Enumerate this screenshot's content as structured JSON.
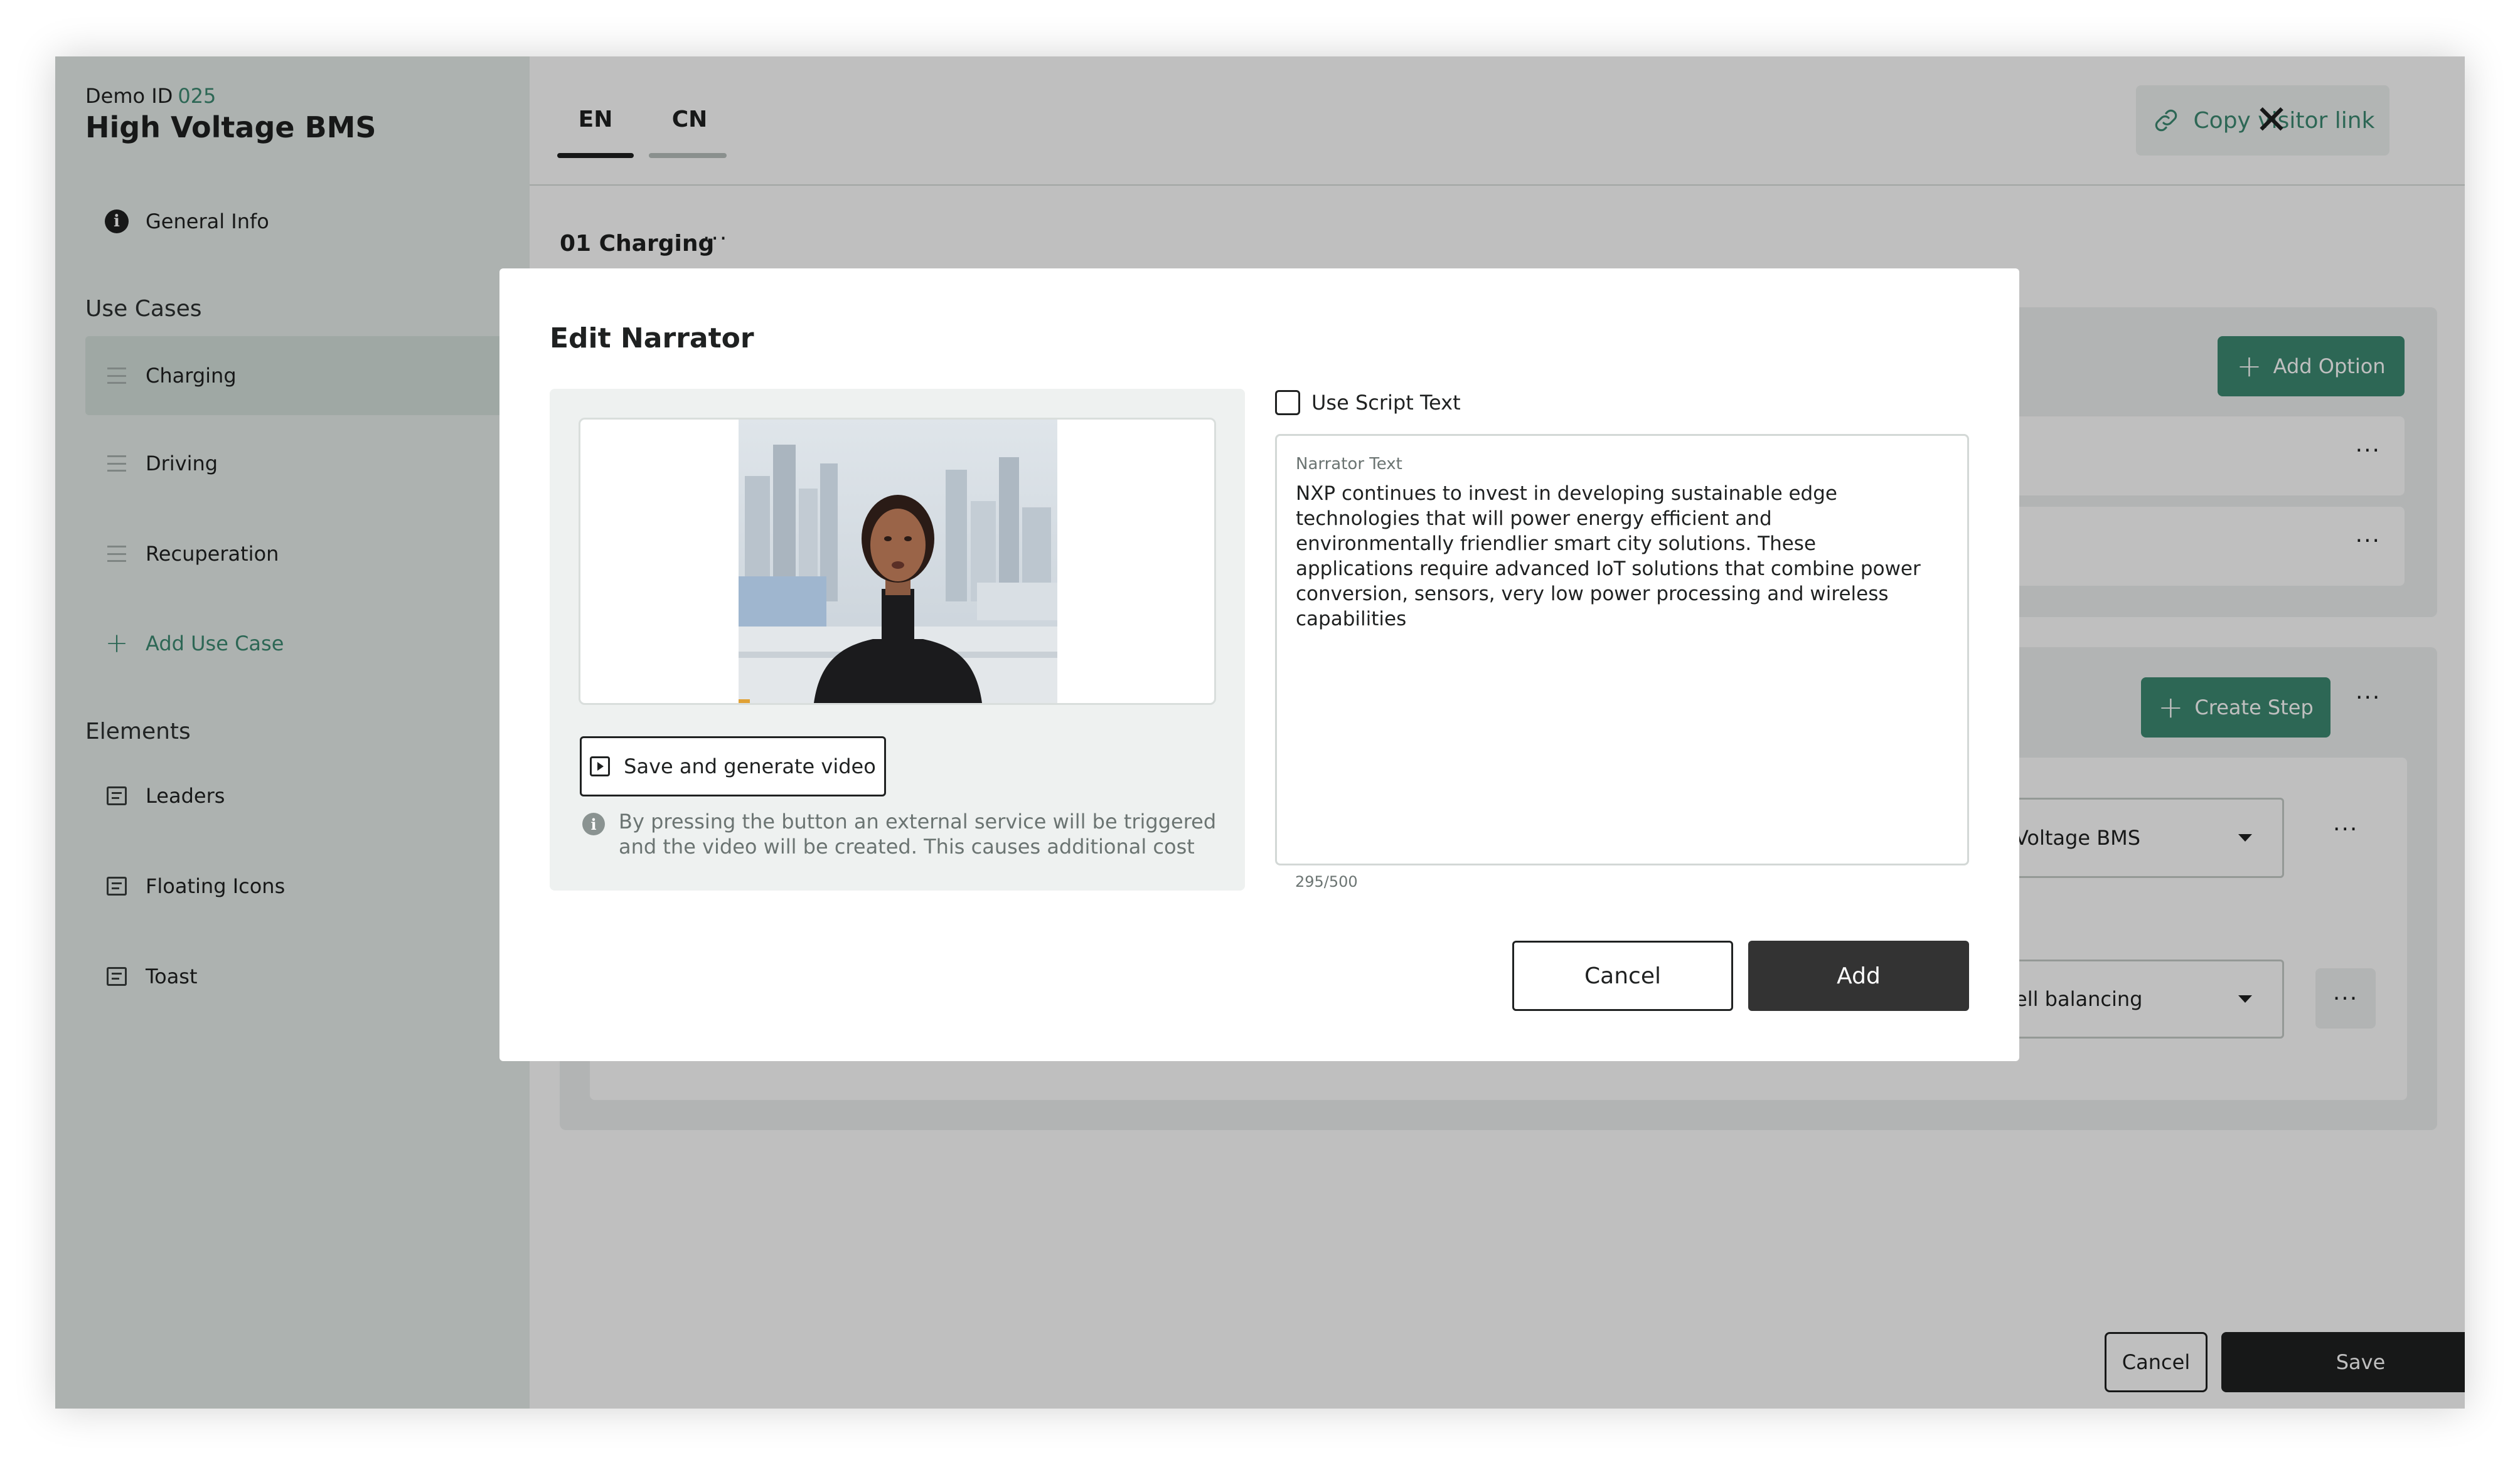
{
  "sidebar": {
    "demo_id_label": "Demo ID",
    "demo_id_value": "025",
    "title": "High Voltage BMS",
    "general_info": "General Info",
    "use_cases_heading": "Use Cases",
    "use_cases": [
      "Charging",
      "Driving",
      "Recuperation"
    ],
    "add_use_case": "Add Use Case",
    "elements_heading": "Elements",
    "elements": [
      "Leaders",
      "Floating Icons",
      "Toast"
    ]
  },
  "header": {
    "tabs": [
      "EN",
      "CN"
    ],
    "copy_link": "Copy visitor link"
  },
  "main": {
    "use_case_title": "01 Charging",
    "more": "···",
    "add_option": "Add Option",
    "create_step": "Create Step",
    "select_1": "Voltage BMS",
    "select_2": "ell balancing",
    "cancel": "Cancel",
    "save": "Save"
  },
  "modal": {
    "title": "Edit Narrator",
    "generate_button": "Save and generate video",
    "hint": "By pressing the button an external service will be triggered and the video will be created. This causes additional cost",
    "use_script_text": "Use Script Text",
    "use_script_checked": false,
    "narrator_label": "Narrator Text",
    "narrator_text": "NXP continues to invest in developing sustainable edge technologies that will power energy efficient and environmentally friendlier smart city solutions. These applications require advanced IoT solutions that combine power conversion, sensors, very low power processing and wireless capabilities",
    "char_count": "295/500",
    "cancel": "Cancel",
    "add": "Add"
  },
  "colors": {
    "accent": "#3d8a72",
    "sidebar_bg": "#e7eeeb",
    "dark_button": "#333333"
  },
  "icons": [
    "info-icon",
    "drag-handle-icon",
    "plus-icon",
    "document-icon",
    "link-icon",
    "close-icon",
    "play-icon",
    "chevron-down-icon"
  ]
}
